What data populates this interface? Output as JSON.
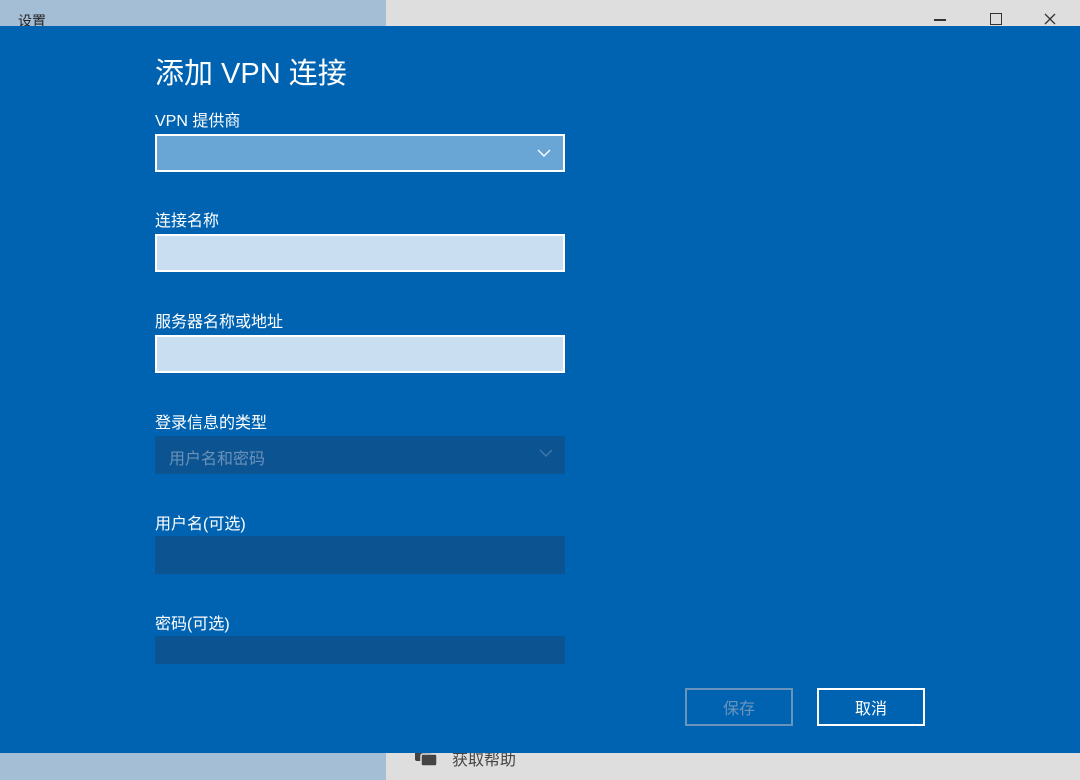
{
  "window": {
    "title": "设置",
    "help_text": "获取帮助"
  },
  "dialog": {
    "title": "添加 VPN 连接",
    "vpn_provider": {
      "label": "VPN 提供商",
      "value": ""
    },
    "connection_name": {
      "label": "连接名称",
      "value": ""
    },
    "server_address": {
      "label": "服务器名称或地址",
      "value": ""
    },
    "signin_type": {
      "label": "登录信息的类型",
      "value": "用户名和密码"
    },
    "username": {
      "label": "用户名(可选)",
      "value": ""
    },
    "password": {
      "label": "密码(可选)",
      "value": ""
    },
    "buttons": {
      "save": "保存",
      "cancel": "取消"
    }
  },
  "icons": {
    "minimize": "minimize-icon",
    "maximize": "maximize-icon",
    "close": "close-icon",
    "dropdown": "chevron-down-icon",
    "help": "chat-help-icon"
  },
  "colors": {
    "dialog_bg": "#0063b1",
    "input_active_bg": "#c9dff1",
    "select_active_bg": "#69a6d6",
    "disabled_field_bg": "#0c5391",
    "disabled_text": "#6b92b8"
  }
}
